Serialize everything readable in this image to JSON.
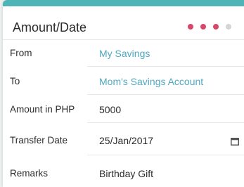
{
  "header": {
    "title": "Amount/Date",
    "steps": [
      {
        "state": "done",
        "color": "#d8466a"
      },
      {
        "state": "done",
        "color": "#d8466a"
      },
      {
        "state": "current",
        "color": "#d8466a"
      },
      {
        "state": "pending",
        "color": "#d4d4d4"
      }
    ]
  },
  "form": {
    "from_label": "From",
    "from_value": "My Savings",
    "to_label": "To",
    "to_value": "Mom's Savings Account",
    "amount_label": "Amount in PHP",
    "amount_value": "5000",
    "date_label": "Transfer Date",
    "date_value": "25/Jan/2017",
    "remarks_label": "Remarks",
    "remarks_value": "Birthday Gift"
  },
  "colors": {
    "accent": "#4fb4b7",
    "link": "#4fa8c2",
    "step_active": "#d8466a",
    "step_inactive": "#d4d4d4"
  },
  "icons": {
    "date_picker": "calendar-icon"
  }
}
